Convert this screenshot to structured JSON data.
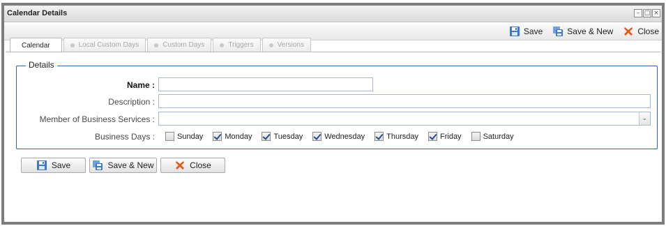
{
  "window": {
    "title": "Calendar Details",
    "controls": [
      "–",
      "□",
      "×"
    ]
  },
  "toolbar": {
    "save_label": "Save",
    "save_new_label": "Save & New",
    "close_label": "Close"
  },
  "tabs": [
    {
      "label": "Calendar",
      "active": true
    },
    {
      "label": "Local Custom Days",
      "active": false
    },
    {
      "label": "Custom Days",
      "active": false
    },
    {
      "label": "Triggers",
      "active": false
    },
    {
      "label": "Versions",
      "active": false
    }
  ],
  "details": {
    "legend": "Details",
    "name_label": "Name :",
    "name_value": "",
    "description_label": "Description :",
    "description_value": "",
    "member_label": "Member of Business Services :",
    "member_value": "",
    "business_days_label": "Business Days :",
    "days": [
      {
        "label": "Sunday",
        "checked": false
      },
      {
        "label": "Monday",
        "checked": true
      },
      {
        "label": "Tuesday",
        "checked": true
      },
      {
        "label": "Wednesday",
        "checked": true
      },
      {
        "label": "Thursday",
        "checked": true
      },
      {
        "label": "Friday",
        "checked": true
      },
      {
        "label": "Saturday",
        "checked": false
      }
    ]
  },
  "bottom_buttons": {
    "save_label": "Save",
    "save_new_label": "Save & New",
    "close_label": "Close"
  },
  "colors": {
    "fieldset_border": "#2e63b5",
    "close_icon": "#e05a1a",
    "save_icon": "#3f78c8"
  }
}
